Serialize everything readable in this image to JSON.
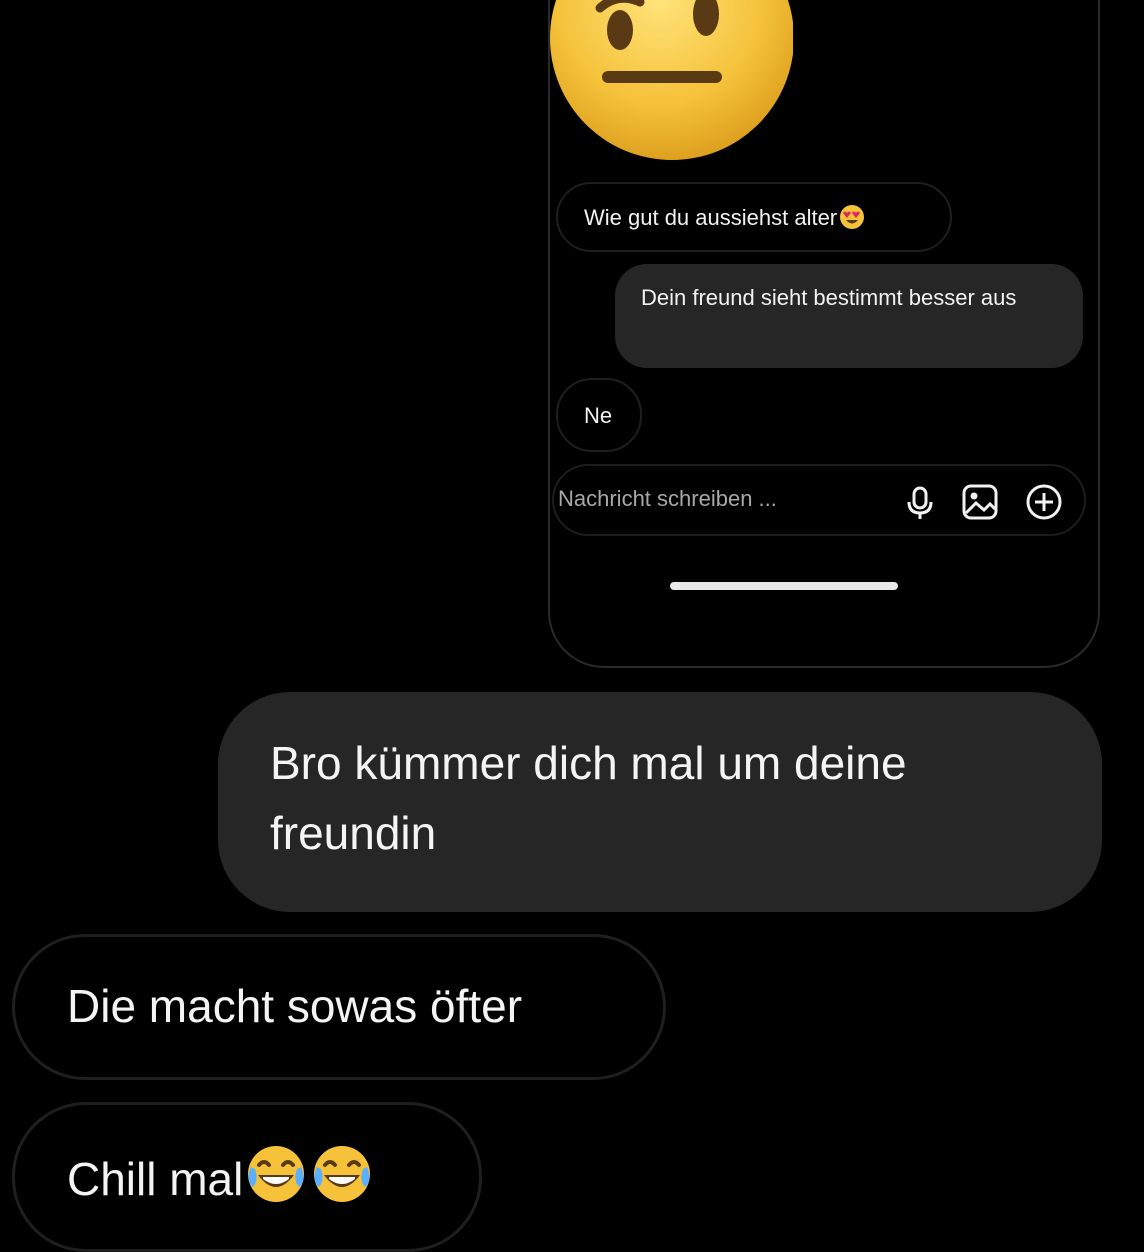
{
  "embedded_chat": {
    "top_emoji": "raised-eyebrow-face-icon",
    "messages": [
      {
        "direction": "received",
        "text": "Wie gut du aussiehst alter",
        "emoji": "heart-eyes-icon"
      },
      {
        "direction": "sent",
        "text": "Dein freund sieht bestimmt besser aus"
      },
      {
        "direction": "received",
        "text": "Ne"
      }
    ],
    "composer": {
      "placeholder": "Nachricht schreiben ...",
      "icons": [
        "microphone-icon",
        "image-icon",
        "add-circle-icon"
      ]
    }
  },
  "chat": {
    "messages": [
      {
        "direction": "sent",
        "text": "Bro kümmer dich mal um deine freundin"
      },
      {
        "direction": "received",
        "text": "Die macht sowas öfter"
      },
      {
        "direction": "received",
        "text": "Chill mal",
        "emoji": "tears-of-joy-icon",
        "emoji_count": 2
      }
    ]
  },
  "colors": {
    "background": "#000000",
    "sent_bubble": "#262626",
    "received_border": "#1f1f1f",
    "emoji_yellow": "#f5c23a"
  }
}
